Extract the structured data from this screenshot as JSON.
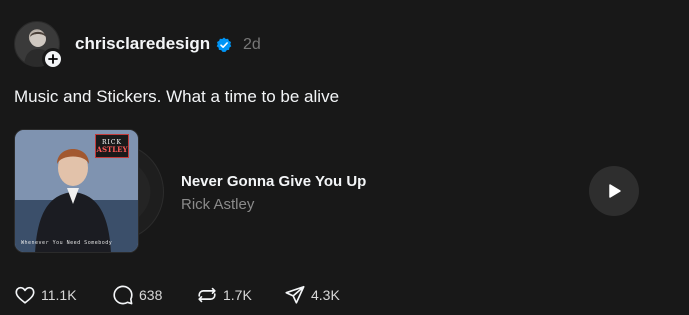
{
  "post": {
    "username": "chrisclaredesign",
    "timestamp": "2d",
    "caption": "Music and Stickers. What a time to be alive"
  },
  "music": {
    "title": "Never Gonna Give You Up",
    "artist": "Rick Astley",
    "album_logo_top": "RICK",
    "album_logo_bottom": "ASTLEY",
    "album_subtitle": "Whenever You Need Somebody"
  },
  "actions": {
    "likes": "11.1K",
    "comments": "638",
    "reposts": "1.7K",
    "shares": "4.3K"
  },
  "colors": {
    "background": "#181818",
    "verified": "#0095f6",
    "secondary_text": "#777777"
  }
}
